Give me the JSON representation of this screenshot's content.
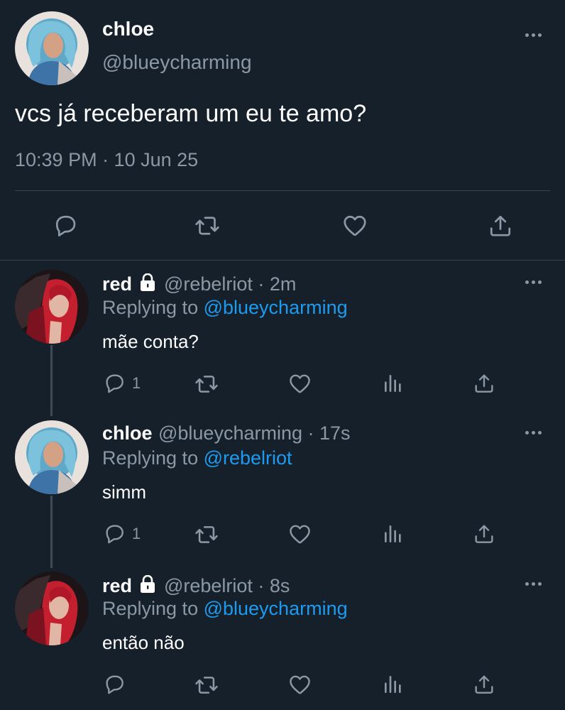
{
  "main_tweet": {
    "name": "chloe",
    "handle": "@blueycharming",
    "text": "vcs já receberam um eu te amo?",
    "timestamp": "10:39 PM · 10 Jun 25"
  },
  "replies": [
    {
      "name": "red",
      "handle": "@rebelriot",
      "time": " · 2m",
      "replying_label": "Replying to ",
      "replying_to": "@blueycharming",
      "text": "mãe conta?",
      "reply_count": "1"
    },
    {
      "name": "chloe",
      "handle": "@blueycharming",
      "time": " · 17s",
      "replying_label": "Replying to ",
      "replying_to": "@rebelriot",
      "text": "simm",
      "reply_count": "1"
    },
    {
      "name": "red",
      "handle": "@rebelriot",
      "time": " · 8s",
      "replying_label": "Replying to ",
      "replying_to": "@blueycharming",
      "text": "então não",
      "reply_count": ""
    }
  ],
  "colors": {
    "background": "#15202b",
    "secondary_text": "#8b98a5",
    "link": "#1d9bf0",
    "divider": "#38444d"
  },
  "icons": [
    "more-icon",
    "reply-icon",
    "retweet-icon",
    "like-icon",
    "share-icon",
    "analytics-icon",
    "lock-icon"
  ]
}
